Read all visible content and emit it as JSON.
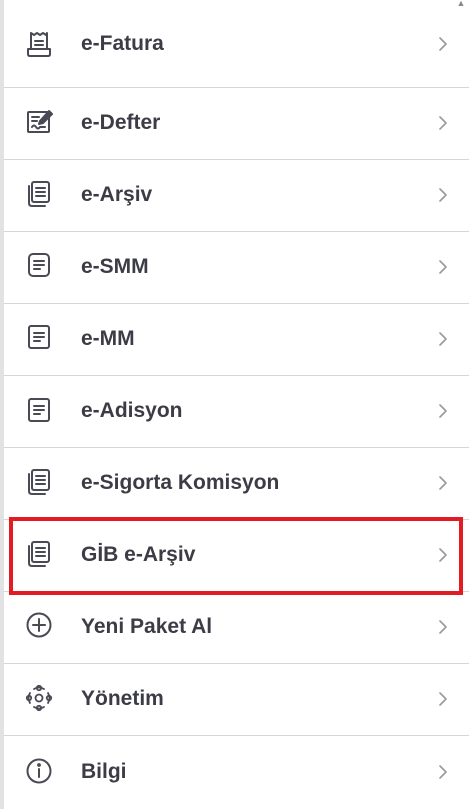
{
  "menu": {
    "items": [
      {
        "label": "e-Fatura",
        "icon": "receipt-icon"
      },
      {
        "label": "e-Defter",
        "icon": "signed-ledger-icon"
      },
      {
        "label": "e-Arşiv",
        "icon": "stacked-documents-icon"
      },
      {
        "label": "e-SMM",
        "icon": "document-icon"
      },
      {
        "label": "e-MM",
        "icon": "document-icon"
      },
      {
        "label": "e-Adisyon",
        "icon": "document-icon"
      },
      {
        "label": "e-Sigorta Komisyon",
        "icon": "stacked-documents-icon"
      },
      {
        "label": "GİB e-Arşiv",
        "icon": "stacked-documents-icon",
        "highlighted": true
      },
      {
        "label": "Yeni Paket Al",
        "icon": "plus-circle-icon"
      },
      {
        "label": "Yönetim",
        "icon": "network-icon"
      },
      {
        "label": "Bilgi",
        "icon": "info-icon"
      }
    ]
  },
  "colors": {
    "text": "#3c3c46",
    "icon": "#4a4a55",
    "chevron": "#9a9a9a",
    "divider": "#d4d6d9",
    "highlight": "#e31b23"
  }
}
